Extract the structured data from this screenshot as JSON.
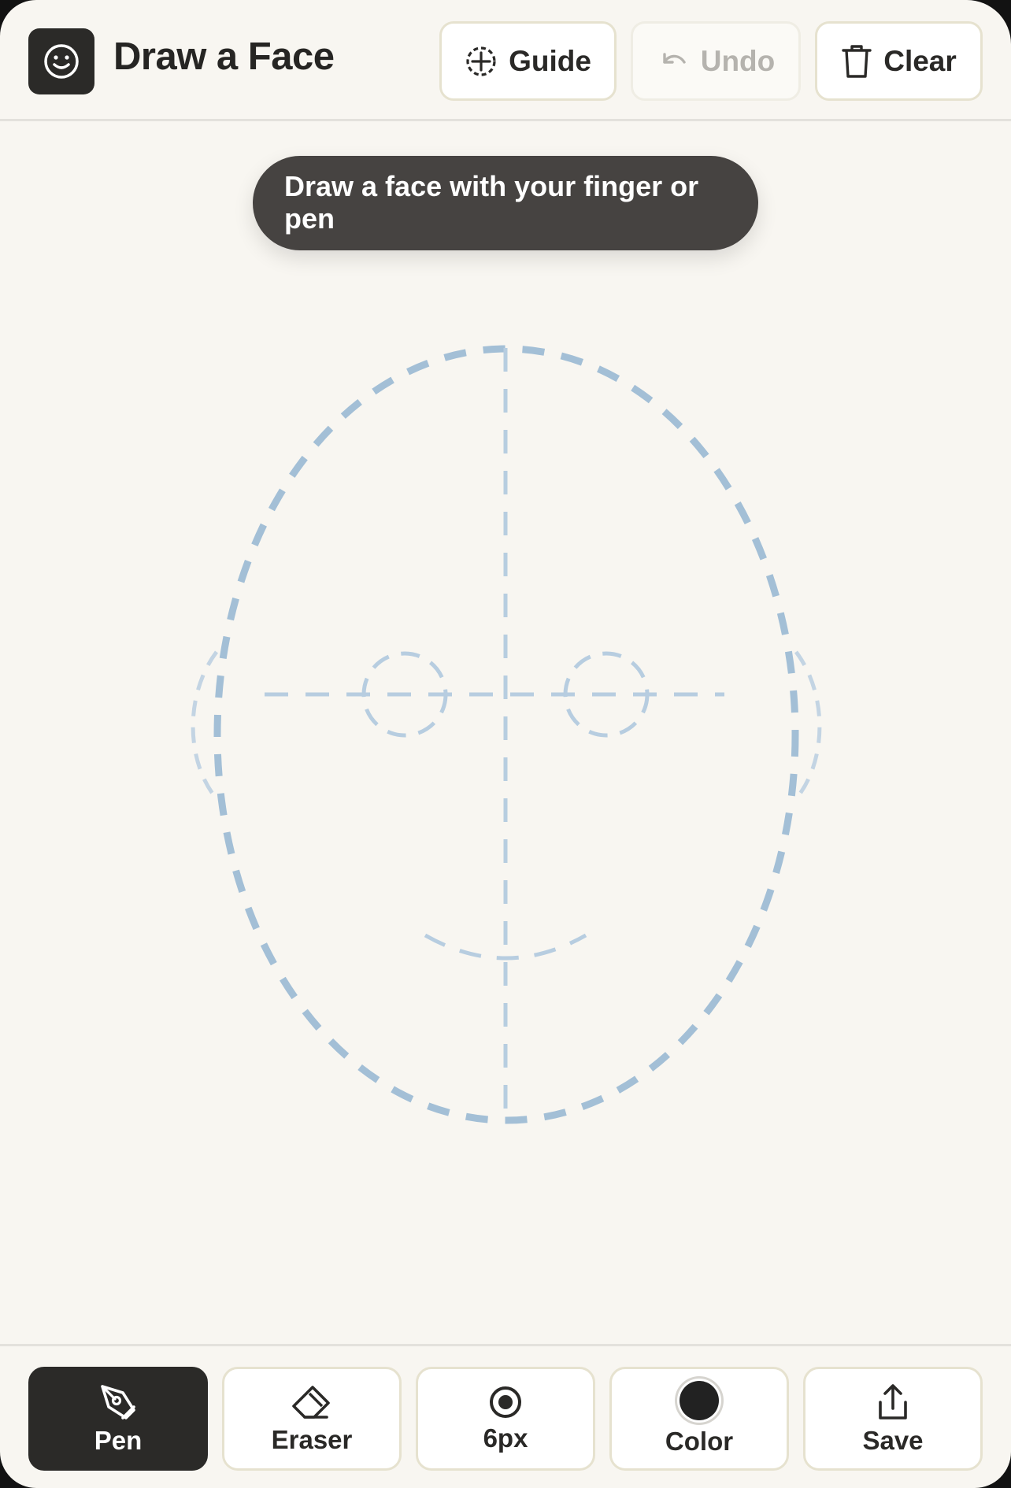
{
  "header": {
    "title": "Draw a Face",
    "app_icon": "smiley-icon",
    "buttons": {
      "guide": {
        "label": "Guide",
        "icon": "crosshair-icon"
      },
      "undo": {
        "label": "Undo",
        "icon": "undo-icon",
        "enabled": false
      },
      "clear": {
        "label": "Clear",
        "icon": "trash-icon"
      }
    }
  },
  "canvas": {
    "hint": "Draw a face with your finger or pen",
    "guide_color": "#a3bfd6"
  },
  "toolbar": {
    "pen": {
      "label": "Pen",
      "icon": "pen-icon",
      "active": true
    },
    "eraser": {
      "label": "Eraser",
      "icon": "eraser-icon"
    },
    "size": {
      "label": "6px",
      "icon": "brush-size-icon"
    },
    "color": {
      "label": "Color",
      "value": "#222222"
    },
    "save": {
      "label": "Save",
      "icon": "share-icon"
    }
  }
}
